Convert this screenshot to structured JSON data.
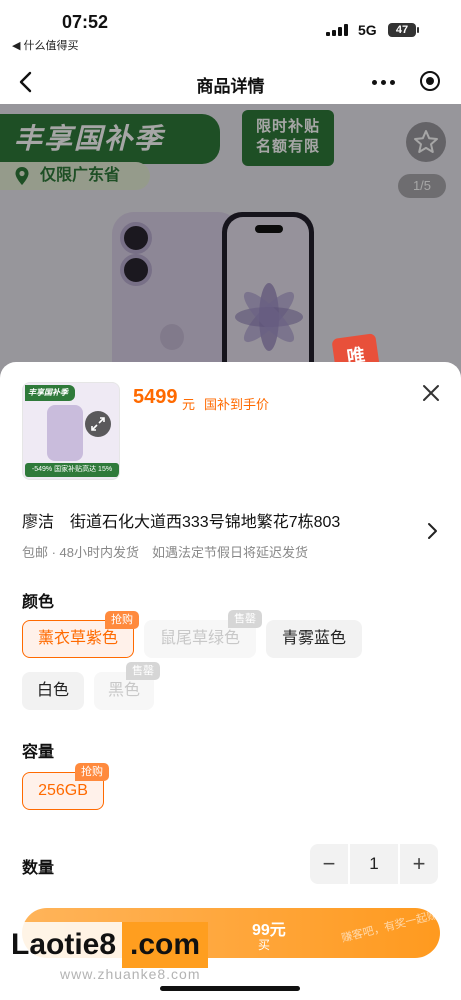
{
  "status_bar": {
    "time": "07:52",
    "back_app": "◀ 什么值得买",
    "network": "5G",
    "battery": "47"
  },
  "nav": {
    "title": "商品详情"
  },
  "banner": {
    "promo_title": "丰享国补季",
    "promo_region": "仅限广东省",
    "promo_limit_line1": "限时补贴",
    "promo_limit_line2": "名额有限",
    "image_counter": "1/5",
    "sticker": "唯"
  },
  "product": {
    "thumb_head": "丰享国补季",
    "thumb_foot": "-549% 国家补贴高达 15%",
    "price": "5499",
    "price_unit": "元",
    "price_tag": "国补到手价"
  },
  "address": {
    "text": "廖洁　街道石化大道西333号锦地繁花7栋803",
    "shipping": "包邮 · 48小时内发货　如遇法定节假日将延迟发货"
  },
  "color": {
    "label": "颜色",
    "options": [
      {
        "label": "薰衣草紫色",
        "badge": "抢购",
        "state": "selected"
      },
      {
        "label": "鼠尾草绿色",
        "badge": "售罄",
        "state": "disabled"
      },
      {
        "label": "青雾蓝色",
        "badge": "",
        "state": "normal"
      },
      {
        "label": "白色",
        "badge": "",
        "state": "normal"
      },
      {
        "label": "黑色",
        "badge": "售罄",
        "state": "disabled"
      }
    ]
  },
  "capacity": {
    "label": "容量",
    "options": [
      {
        "label": "256GB",
        "badge": "抢购",
        "state": "selected"
      }
    ]
  },
  "quantity": {
    "label": "数量",
    "minus": "−",
    "value": "1",
    "plus": "+"
  },
  "buy": {
    "price": "99元",
    "sub": "买"
  },
  "watermark": {
    "part1": "Laotie8",
    "part2": ".com",
    "url": "www.zhuanke8.com",
    "faint": "赚客吧，有奖一起赚"
  },
  "colors": {
    "accent": "#ff6a00",
    "promo_green": "#2f7a3a",
    "buy_orange": "#ff9a1f"
  }
}
